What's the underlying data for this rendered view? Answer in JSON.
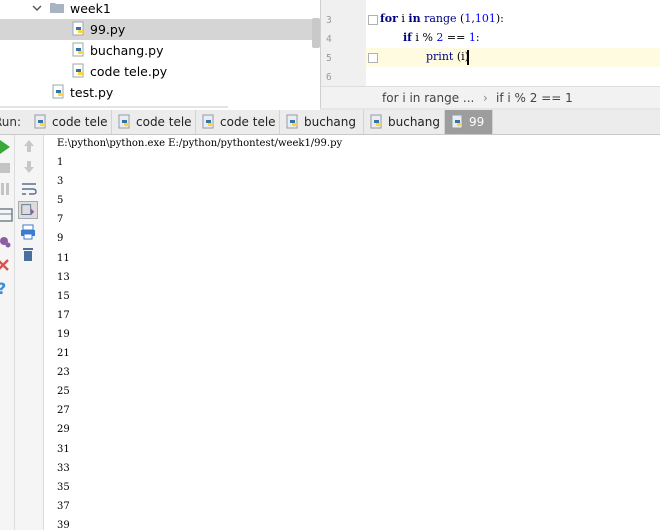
{
  "tree": {
    "folder": "week1",
    "files": [
      "99.py",
      "buchang.py",
      "code tele.py"
    ],
    "root_file": "test.py"
  },
  "editor": {
    "lines": [
      {
        "no": "3",
        "tokens": [
          [
            "kw",
            "for"
          ],
          [
            "var",
            " i "
          ],
          [
            "kw",
            "in"
          ],
          [
            "fn",
            " range "
          ],
          [
            "var",
            "("
          ],
          [
            "num",
            "1"
          ],
          [
            "var",
            ","
          ],
          [
            "num",
            "101"
          ],
          [
            "var",
            "):"
          ]
        ]
      },
      {
        "no": "4",
        "tokens": [
          [
            "kw",
            "if"
          ],
          [
            "var",
            " i "
          ],
          [
            "var",
            "% "
          ],
          [
            "num",
            "2"
          ],
          [
            "var",
            " == "
          ],
          [
            "num",
            "1"
          ],
          [
            "var",
            ":"
          ]
        ]
      },
      {
        "no": "5",
        "tokens": [
          [
            "fn",
            "print"
          ],
          [
            "var",
            " (i)"
          ]
        ]
      },
      {
        "no": "6",
        "tokens": []
      }
    ],
    "breadcrumb": [
      "for i in range ...",
      "›",
      "if i % 2 == 1"
    ]
  },
  "run": {
    "label": "Run:",
    "tabs": [
      "code tele",
      "code tele",
      "code tele",
      "buchang",
      "buchang",
      "99"
    ],
    "active_tab": 5
  },
  "console": {
    "command": "E:\\python\\python.exe E:/python/pythontest/week1/99.py",
    "output": [
      "1",
      "3",
      "5",
      "7",
      "9",
      "11",
      "13",
      "15",
      "17",
      "19",
      "21",
      "23",
      "25",
      "27",
      "29",
      "31",
      "33",
      "35",
      "37",
      "39"
    ]
  },
  "colors": {
    "keyword": "#000080",
    "number": "#0000ff",
    "selected_row": "#d5d5d5",
    "active_tab": "#9d9d9d",
    "run_green": "#3aa83a",
    "stop_red": "#d9534f"
  }
}
